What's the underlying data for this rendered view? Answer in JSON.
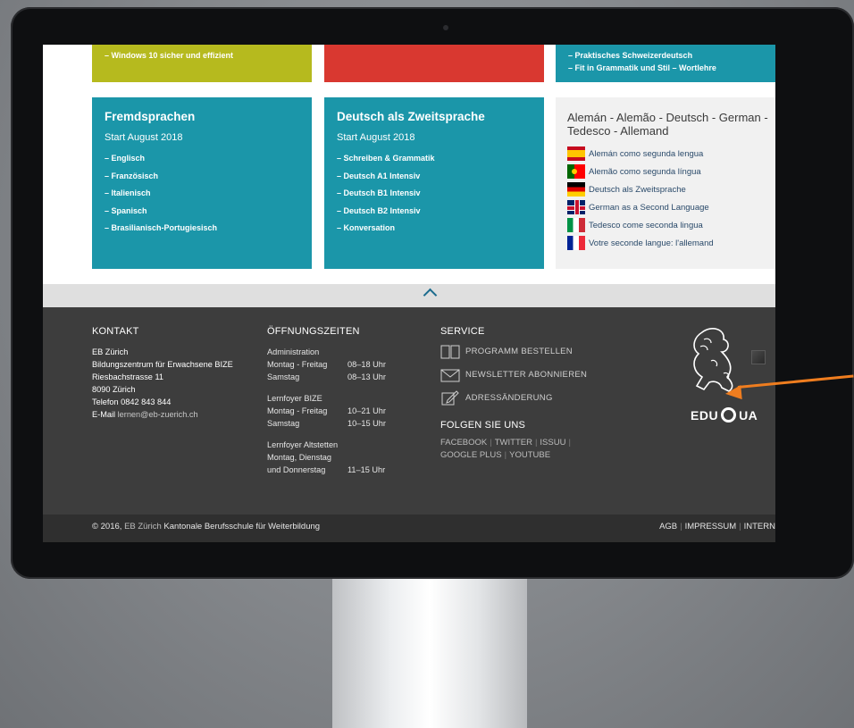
{
  "top_tiles": {
    "green_item": "–  Windows 10 sicher und effizient",
    "teal_items": [
      "–  Praktisches Schweizerdeutsch",
      "–  Fit in Grammatik und Stil – Wortlehre"
    ]
  },
  "fremdsprachen": {
    "title": "Fremdsprachen",
    "start": "Start August 2018",
    "items": [
      "–  Englisch",
      "–  Französisch",
      "–  Italienisch",
      "–  Spanisch",
      "–  Brasilianisch-Portugiesisch"
    ]
  },
  "daz": {
    "title": "Deutsch als Zweitsprache",
    "start": "Start August 2018",
    "items": [
      "–  Schreiben & Grammatik",
      "–  Deutsch A1 Intensiv",
      "–  Deutsch B1 Intensiv",
      "–  Deutsch B2 Intensiv",
      "–  Konversation"
    ]
  },
  "languages": {
    "title": "Alemán - Alemão - Deutsch - German - Tedesco - Allemand",
    "items": [
      {
        "label": "Alemán como segunda lengua",
        "icon": "flag-spain-icon"
      },
      {
        "label": "Alemão como segunda língua",
        "icon": "flag-portugal-icon"
      },
      {
        "label": "Deutsch als Zweitsprache",
        "icon": "flag-germany-icon"
      },
      {
        "label": "German as a Second Language",
        "icon": "flag-uk-icon"
      },
      {
        "label": "Tedesco come seconda lingua",
        "icon": "flag-italy-icon"
      },
      {
        "label": "Votre seconde langue: l'allemand",
        "icon": "flag-france-icon"
      }
    ]
  },
  "kontakt": {
    "heading": "KONTAKT",
    "name": "EB Zürich",
    "org": "Bildungszentrum für Erwachsene BIZE",
    "street": "Riesbachstrasse 11",
    "city": "8090 Zürich",
    "phone": "Telefon 0842 843 844",
    "email_label": "E-Mail",
    "email": "lernen@eb-zuerich.ch"
  },
  "zeiten": {
    "heading": "ÖFFNUNGSZEITEN",
    "admin_title": "Administration",
    "admin_rows": [
      [
        "Montag - Freitag",
        "08–18 Uhr"
      ],
      [
        "Samstag",
        "08–13 Uhr"
      ]
    ],
    "bize_title": "Lernfoyer BIZE",
    "bize_rows": [
      [
        "Montag - Freitag",
        "10–21 Uhr"
      ],
      [
        "Samstag",
        "10–15 Uhr"
      ]
    ],
    "alt_title": "Lernfoyer Altstetten",
    "alt_line": "Montag, Dienstag",
    "alt_row": [
      "und Donnerstag",
      "11–15 Uhr"
    ]
  },
  "service": {
    "heading": "SERVICE",
    "items": [
      {
        "label": "PROGRAMM BESTELLEN",
        "icon": "book-icon"
      },
      {
        "label": "NEWSLETTER ABONNIEREN",
        "icon": "envelope-icon"
      },
      {
        "label": "ADRESSÄNDERUNG",
        "icon": "edit-icon"
      }
    ],
    "follow_heading": "FOLGEN SIE UNS",
    "social": [
      "FACEBOOK",
      "TWITTER",
      "ISSUU",
      "GOOGLE PLUS",
      "YOUTUBE"
    ]
  },
  "logo": {
    "text_left": "EDU",
    "text_right": "UA"
  },
  "bottom": {
    "copyright": "© 2016,",
    "org_short": "EB Zürich",
    "org_long": "Kantonale Berufsschule für Weiterbildung",
    "links": [
      "AGB",
      "IMPRESSUM",
      "INTERN"
    ]
  },
  "colors": {
    "green": "#b6ba1e",
    "red": "#d93830",
    "teal": "#1b96a9",
    "footer": "#3d3d3d",
    "arrow": "#ef7d1f"
  }
}
